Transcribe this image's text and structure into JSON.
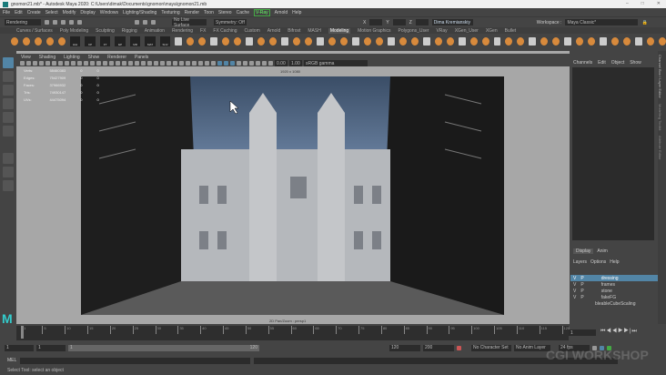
{
  "title": "gnomon21.mb* - Autodesk Maya 2020: C:\\Users\\dimak\\Documents\\gnomon\\maya\\gnomon21.mb",
  "menu": [
    "File",
    "Edit",
    "Create",
    "Select",
    "Modify",
    "Display",
    "Windows",
    "Lighting/Shading",
    "Texturing",
    "Render",
    "Toon",
    "Stereo",
    "Cache",
    "V-Ray",
    "Arnold",
    "Help"
  ],
  "status": {
    "menuset": "Rendering",
    "surface": "No Live Surface",
    "symmetry": "Symmetry: Off",
    "user": "Dima Kremianskiy",
    "workspace_label": "Workspace :",
    "workspace": "Maya Classic*",
    "x": "X",
    "y": "Y",
    "z": "Z"
  },
  "shelf_tabs": [
    "Curves / Surfaces",
    "Poly Modeling",
    "Sculpting",
    "Rigging",
    "Animation",
    "Rendering",
    "FX",
    "FX Caching",
    "Custom",
    "Arnold",
    "Bifrost",
    "MASH",
    "Modeling",
    "Motion Graphics",
    "Polygons_User",
    "VRay",
    "XGen_User",
    "XGen",
    "Bullet"
  ],
  "shelf_active": "Modeling",
  "shelf_labels": [
    "Hist",
    "CP",
    "FT",
    "EP",
    "MR",
    "MAT",
    "SUV"
  ],
  "panel_menu": [
    "View",
    "Shading",
    "Lighting",
    "Show",
    "Renderer",
    "Panels"
  ],
  "panel_toolbar": {
    "exposure": "0.00",
    "gamma": "1.00",
    "colorspace": "sRGB gamma"
  },
  "stats": [
    {
      "k": "Verts:",
      "v": "58460383",
      "a": "0",
      "b": "0"
    },
    {
      "k": "Edges:",
      "v": "75427909",
      "a": "0",
      "b": "0"
    },
    {
      "k": "Faces:",
      "v": "37966932",
      "a": "0",
      "b": "0"
    },
    {
      "k": "Tris:",
      "v": "74930147",
      "a": "0",
      "b": "0"
    },
    {
      "k": "UVs:",
      "v": "44475094",
      "a": "0",
      "b": "0"
    }
  ],
  "resolution": "1920 x 1080",
  "camera": "2D Pan/Zoom : persp1",
  "channel_box": {
    "menu": [
      "Channels",
      "Edit",
      "Object",
      "Show"
    ]
  },
  "vertical_tabs": [
    "Channel Box / Layer Editor",
    "Modelling Toolkit",
    "Attribute Editor"
  ],
  "layer_editor": {
    "tabs": [
      "Display",
      "Anim"
    ],
    "menu": [
      "Layers",
      "Options",
      "Help"
    ],
    "layers": [
      {
        "v": "V",
        "p": "P",
        "name": "dressing",
        "selected": true
      },
      {
        "v": "V",
        "p": "P",
        "name": "frames"
      },
      {
        "v": "V",
        "p": "P",
        "name": "stone"
      },
      {
        "v": "V",
        "p": "P",
        "name": "fakeFG"
      },
      {
        "v": "",
        "p": "",
        "name": "bleableCubeScaling"
      }
    ]
  },
  "timeline": {
    "ticks": [
      "1",
      "5",
      "10",
      "15",
      "20",
      "25",
      "30",
      "35",
      "40",
      "45",
      "50",
      "55",
      "60",
      "65",
      "70",
      "75",
      "80",
      "85",
      "90",
      "95",
      "100",
      "105",
      "110",
      "115",
      "120"
    ],
    "current_frame": "1"
  },
  "range": {
    "start": "1",
    "playback_start": "1",
    "range_start_label": "1",
    "range_end_label": "120",
    "playback_end": "120",
    "end": "200",
    "character_set": "No Character Set",
    "anim_layer": "No Anim Layer",
    "fps": "24 fps"
  },
  "mel": {
    "label": "MEL"
  },
  "help_line": "Select Tool: select an object",
  "watermark": "CGI WORKSHOP",
  "accent": "#5285a6"
}
